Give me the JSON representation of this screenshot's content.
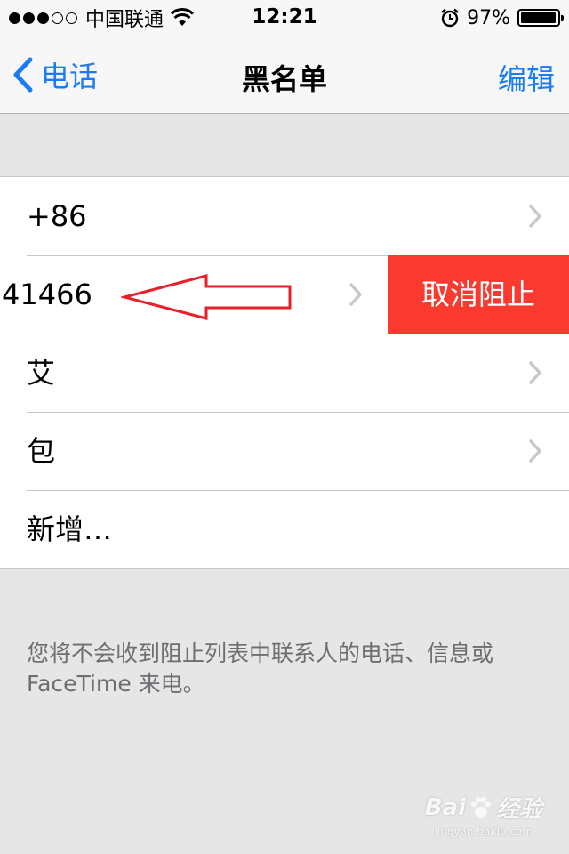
{
  "status_bar": {
    "carrier": "中国联通",
    "time": "12:21",
    "battery_percent": "97%",
    "signal_bars_filled": 3,
    "signal_bars_total": 5,
    "battery_level": 0.97
  },
  "nav": {
    "back_label": "电话",
    "title": "黑名单",
    "edit_label": "编辑"
  },
  "list": {
    "rows": [
      {
        "label": "+86"
      },
      {
        "label": "41466",
        "action_label": "取消阻止"
      },
      {
        "label": "艾"
      },
      {
        "label": "包"
      },
      {
        "label": "新增…"
      }
    ]
  },
  "footer_note": "您将不会收到阻止列表中联系人的电话、信息或 FaceTime 来电。",
  "watermark": {
    "logo_left": "Bai",
    "logo_right": "经验",
    "url": "jingyan.baidu.com"
  },
  "colors": {
    "accent": "#1a7cf5",
    "destructive": "#fb3a2f",
    "annotation": "#e8202a"
  }
}
